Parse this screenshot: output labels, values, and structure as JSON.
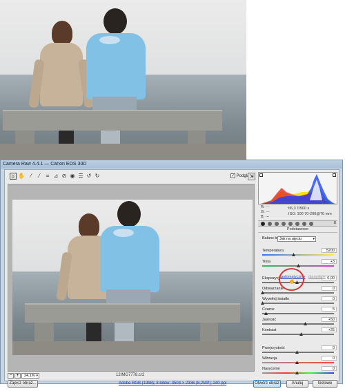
{
  "window": {
    "title": "Camera Raw 4.4.1 — Canon EOS 30D"
  },
  "toolbar": {
    "tools": [
      "zoom-icon",
      "hand-icon",
      "white-balance-icon",
      "color-sampler-icon",
      "crop-icon",
      "straighten-icon",
      "spot-removal-icon",
      "red-eye-icon",
      "preferences-icon",
      "rotate-ccw-icon",
      "rotate-cw-icon"
    ],
    "preview_label": "Podgląd",
    "preview_checked": true
  },
  "preview": {
    "zoom": "24,1%",
    "filename": "12IMG7778.cr2"
  },
  "histogram": {
    "colors": [
      "#1a44ff",
      "#ffd800",
      "#e02020",
      "#20c040"
    ]
  },
  "readout": {
    "r_label": "R:",
    "r_val": "---",
    "g_label": "G:",
    "g_val": "---",
    "b_label": "B:",
    "b_val": "---",
    "exposure": "f/6,3   1/500 s",
    "iso": "ISO: 100   70-200@70 mm"
  },
  "panel": {
    "title": "Podstawowe",
    "wb_label": "Balans bieli:",
    "wb_value": "Jak na ujęciu",
    "auto_label": "automatycznie",
    "default_label": "domyślnie",
    "controls": [
      {
        "label": "Temperatura",
        "value": "5200",
        "pos": 0.45
      },
      {
        "label": "Tinta",
        "value": "+3",
        "pos": 0.52
      },
      {
        "label": "Ekspozycja",
        "value": "0,00",
        "pos": 0.5
      },
      {
        "label": "Odtwarzanie",
        "value": "0",
        "pos": 0.0
      },
      {
        "label": "Wypełnij światło",
        "value": "0",
        "pos": 0.0
      },
      {
        "label": "Czarne",
        "value": "5",
        "pos": 0.05
      },
      {
        "label": "Jasność",
        "value": "+50",
        "pos": 0.62
      },
      {
        "label": "Kontrast",
        "value": "+25",
        "pos": 0.56
      },
      {
        "label": "Przejrzystość",
        "value": "0",
        "pos": 0.5
      },
      {
        "label": "Wibracja",
        "value": "0",
        "pos": 0.5
      },
      {
        "label": "Nasycenie",
        "value": "0",
        "pos": 0.5
      }
    ]
  },
  "footer": {
    "save_label": "Zapisz obraz...",
    "info": "Adobe RGB (1998); 8 bitów; 3504 × 2336 (8,2MP); 240 ppi",
    "open_label": "Otwórz obraz",
    "cancel_label": "Anuluj",
    "done_label": "Gotowe"
  }
}
